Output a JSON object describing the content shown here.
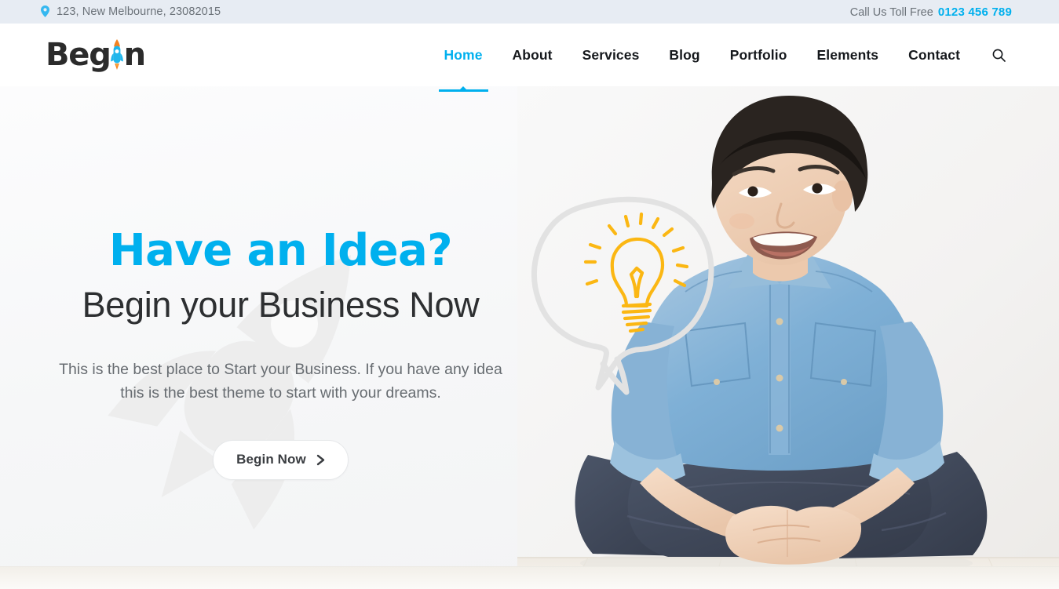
{
  "topbar": {
    "pin_icon": "map-pin-icon",
    "address": "123, New Melbourne, 23082015",
    "toll_label": "Call Us Toll Free",
    "toll_number": "0123 456 789"
  },
  "header": {
    "logo": {
      "text_before": "Beg",
      "text_after": "n",
      "rocket_icon": "rocket-icon",
      "full_text": "Begin"
    },
    "nav": [
      {
        "label": "Home",
        "active": true
      },
      {
        "label": "About",
        "active": false
      },
      {
        "label": "Services",
        "active": false
      },
      {
        "label": "Blog",
        "active": false
      },
      {
        "label": "Portfolio",
        "active": false
      },
      {
        "label": "Elements",
        "active": false
      },
      {
        "label": "Contact",
        "active": false
      }
    ],
    "search_icon": "search-icon"
  },
  "hero": {
    "title": "Have an Idea?",
    "subtitle": "Begin your Business Now",
    "description": "This is the best place to Start your Business. If you have any idea this is the best theme to start with your dreams.",
    "cta_label": "Begin Now",
    "cta_icon": "chevron-right-icon",
    "bubble_icon": "thought-bubble-icon",
    "bulb_icon": "lightbulb-icon",
    "watermark_icon": "rocket-watermark-icon",
    "photo_alt": "smiling-man-denim-shirt-photo"
  },
  "colors": {
    "accent_blue": "#00b0ee",
    "topbar_bg": "#e7ecf3",
    "nav_text": "#15181c",
    "body_text": "#676c71",
    "heading_dark": "#2d2f31",
    "bulb_yellow": "#fbb713",
    "bubble_gray": "#e0e0e0",
    "rocket_orange": "#f58220"
  }
}
